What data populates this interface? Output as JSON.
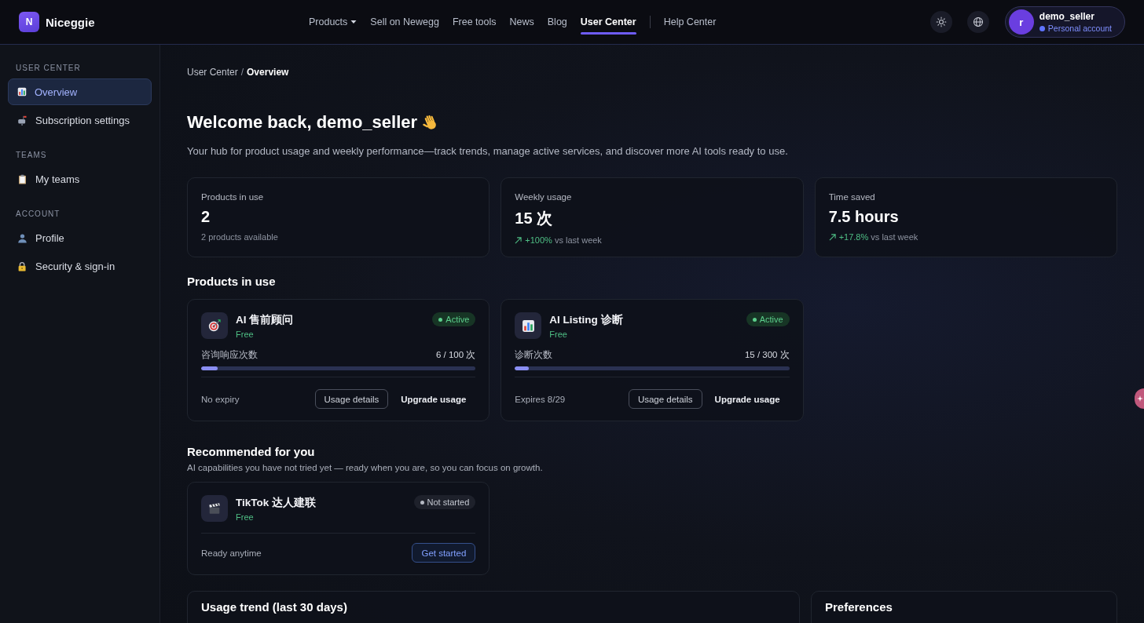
{
  "brand": {
    "initial": "N",
    "name": "Niceggie"
  },
  "nav": [
    {
      "label": "Products",
      "kind": "menu",
      "selected": false
    },
    {
      "label": "Sell on Newegg",
      "kind": "link",
      "selected": false
    },
    {
      "label": "Free tools",
      "kind": "link",
      "selected": false
    },
    {
      "label": "News",
      "kind": "link",
      "selected": false
    },
    {
      "label": "Blog",
      "kind": "link",
      "selected": false
    },
    {
      "label": "User Center",
      "kind": "link",
      "selected": true
    }
  ],
  "nav_secondary": [
    {
      "label": "Help Center",
      "selected": false
    }
  ],
  "user": {
    "initial": "r",
    "name": "demo_seller",
    "account": "Personal account"
  },
  "sidebar": [
    {
      "title": "USER CENTER",
      "items": [
        {
          "label": "Overview",
          "selected": true
        },
        {
          "label": "Subscription settings",
          "selected": false
        }
      ]
    },
    {
      "title": "TEAMS",
      "items": [
        {
          "label": "My teams",
          "selected": false
        }
      ]
    },
    {
      "title": "ACCOUNT",
      "items": [
        {
          "label": "Profile",
          "selected": false
        },
        {
          "label": "Security & sign-in",
          "selected": false
        }
      ]
    }
  ],
  "breadcrumb": {
    "separator": "/",
    "items": [
      {
        "label": "User Center",
        "current": false
      },
      {
        "label": "Overview",
        "current": true
      }
    ]
  },
  "heading": {
    "title": "Welcome back, demo_seller",
    "subtitle": "Your hub for product usage and weekly performance—track trends, manage active services, and discover more AI tools ready to use."
  },
  "stats": [
    {
      "kind": "plain",
      "label": "Products in use",
      "value": "2",
      "note": "2 products available"
    },
    {
      "kind": "trend",
      "label": "Weekly usage",
      "value": "15 次",
      "change": "+100%",
      "note": "vs last week"
    },
    {
      "kind": "trend",
      "label": "Time saved",
      "value": "7.5 hours",
      "change": "+17.8%",
      "note": "vs last week"
    }
  ],
  "products_in_use": {
    "title": "Products in use",
    "items": [
      {
        "name": "AI 售前顾问",
        "plan": "Free",
        "status": "Active",
        "active": true,
        "metric": "咨询响应次数",
        "usage": "6 / 100 次",
        "level": 0.06,
        "expiry": "No expiry",
        "actions": [
          {
            "label": "Usage details",
            "kind": "outline"
          },
          {
            "label": "Upgrade usage",
            "kind": "text"
          }
        ]
      },
      {
        "name": "AI Listing 诊断",
        "plan": "Free",
        "status": "Active",
        "active": true,
        "metric": "诊断次数",
        "usage": "15 / 300 次",
        "level": 0.05,
        "expiry": "Expires 8/29",
        "actions": [
          {
            "label": "Usage details",
            "kind": "outline"
          },
          {
            "label": "Upgrade usage",
            "kind": "text"
          }
        ]
      }
    ]
  },
  "recommended": {
    "title": "Recommended for you",
    "subtitle": "AI capabilities you have not tried yet — ready when you are, so you can focus on growth.",
    "items": [
      {
        "name": "TikTok 达人建联",
        "plan": "Free",
        "status": "Not started",
        "active": false,
        "note": "Ready anytime",
        "actions": [
          {
            "label": "Get started",
            "kind": "accent"
          }
        ]
      }
    ]
  },
  "panels": [
    {
      "title": "Usage trend (last 30 days)"
    },
    {
      "title": "Preferences"
    }
  ]
}
